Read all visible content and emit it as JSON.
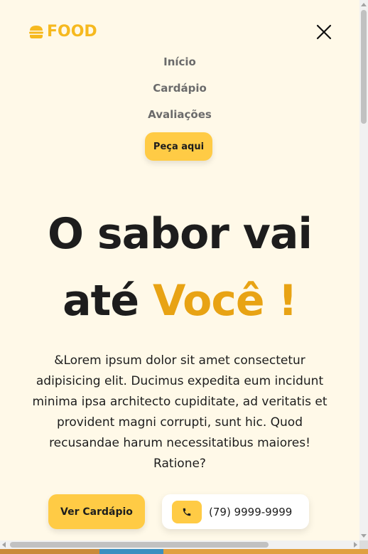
{
  "header": {
    "logo_text": "FOOD",
    "logo_icon": "burger-icon",
    "close_icon": "close-icon"
  },
  "nav": {
    "items": [
      "Início",
      "Cardápio",
      "Avaliações"
    ],
    "order_label": "Peça aqui"
  },
  "hero": {
    "title_line1": "O sabor vai",
    "title_line2_plain": "até ",
    "title_line2_accent": "Você !",
    "description": "&Lorem ipsum dolor sit amet consectetur adipisicing elit. Ducimus expedita eum incidunt minima ipsa architecto cupiditate, ad veritatis et provident magni corrupti, sunt hic. Quod recusandae harum necessitatibus maiores! Ratione?",
    "menu_button_label": "Ver Cardápio",
    "phone_icon": "phone-icon",
    "phone_number": "(79) 9999-9999"
  },
  "colors": {
    "background": "#fff9e8",
    "primary": "#ffcb45",
    "accent_text": "#e8a314",
    "logo": "#f6b91f",
    "text": "#1d1d1d"
  }
}
